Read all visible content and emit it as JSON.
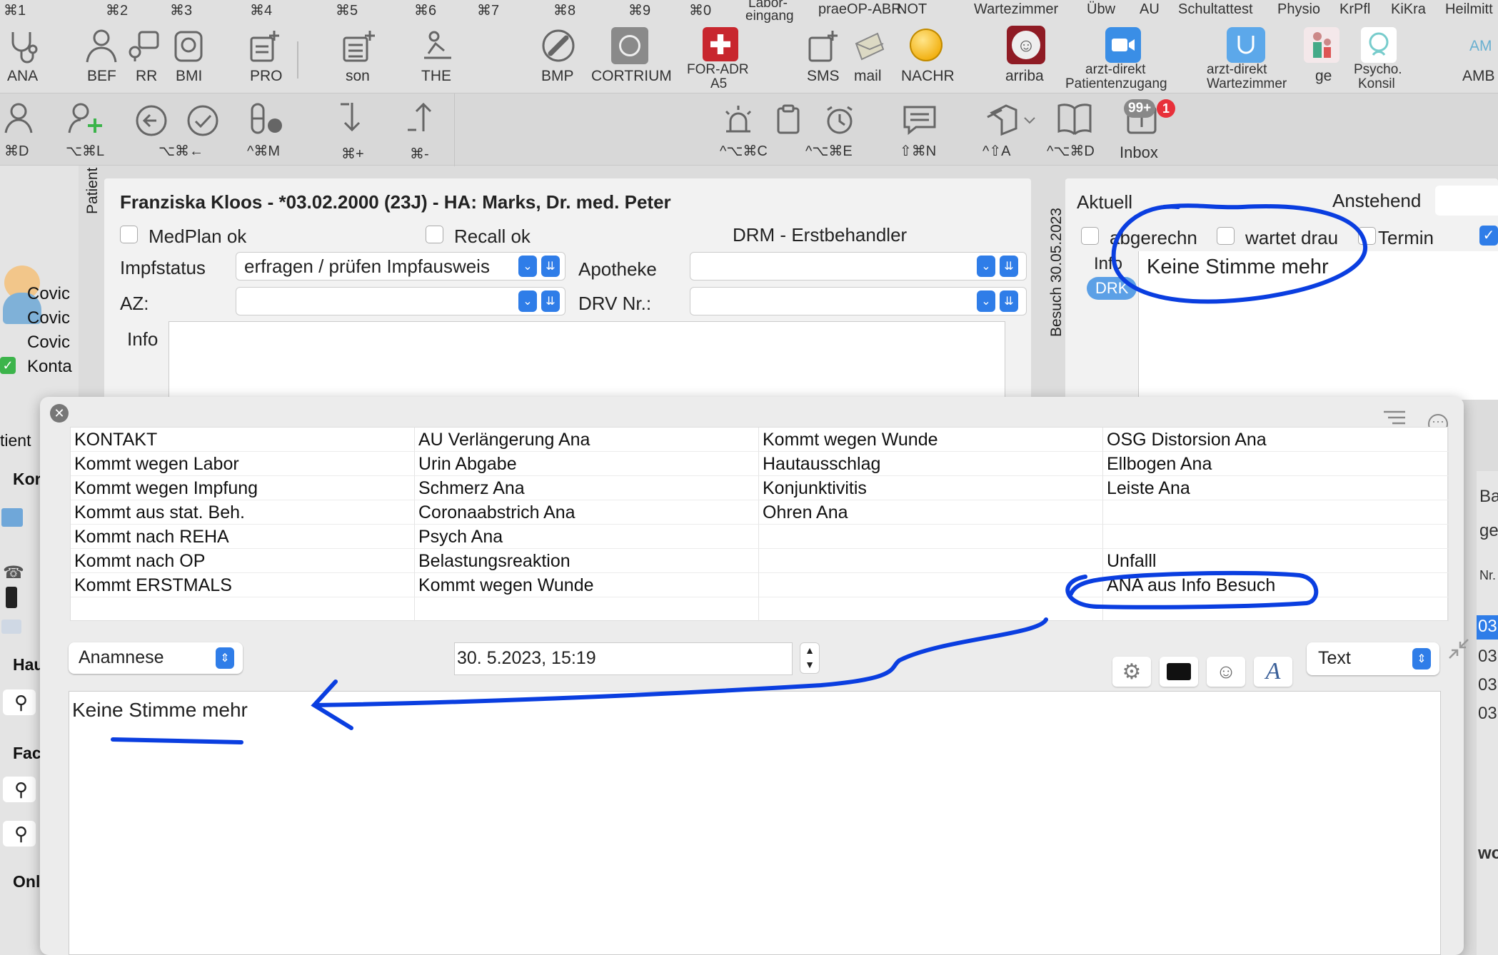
{
  "toolbar_row1": {
    "shortcuts": [
      "⌘1",
      "⌘2",
      "⌘3",
      "⌘4",
      "⌘5",
      "⌘6",
      "⌘7",
      "⌘8",
      "⌘9",
      "⌘0"
    ],
    "categories": [
      "Labor-",
      "eingang",
      "praeOP-ABR",
      "NOT",
      "Wartezimmer",
      "Übw",
      "AU",
      "Schultattest",
      "Physio",
      "KrPfl",
      "KiKra",
      "Heilmitt"
    ],
    "items": [
      "ANA",
      "BEF",
      "RR",
      "BMI",
      "PRO",
      "son",
      "THE",
      "BMP",
      "CORTRIUM",
      "FOR-ADR",
      "A5",
      "SMS",
      "mail",
      "NACHR",
      "arriba",
      "arzt-direkt",
      "Patientenzugang",
      "arzt-direkt",
      "Wartezimmer",
      "ge",
      "Psycho.",
      "Konsil",
      "AMB",
      "AM"
    ]
  },
  "toolbar_row2": {
    "shortcuts": [
      "⌘D",
      "⌥⌘L",
      "⌥⌘←",
      "^⌘M",
      "⌘+",
      "⌘-",
      "^⌥⌘C",
      "^⌥⌘E",
      "⇧⌘N",
      "^⇧A",
      "^⌥⌘D"
    ],
    "inbox_label": "Inbox",
    "inbox_badge": "99+",
    "inbox_alert": "1"
  },
  "sidebar": {
    "items": [
      "Covic",
      "Covic",
      "Covic",
      "Konta"
    ],
    "sections": [
      "tient",
      "Kor",
      "Hau",
      "Fac",
      "Onl"
    ]
  },
  "patient": {
    "vertical_label": "Patient",
    "header": "Franziska Kloos - *03.02.2000 (23J) - HA: Marks, Dr. med. Peter",
    "medplan_label": "MedPlan ok",
    "recall_label": "Recall ok",
    "drm_label": "DRM - Erstbehandler",
    "impfstatus_label": "Impfstatus",
    "impfstatus_value": "erfragen / prüfen Impfausweis",
    "apotheke_label": "Apotheke",
    "az_label": "AZ:",
    "drv_label": "DRV Nr.:",
    "info_label": "Info"
  },
  "visit": {
    "vertical_label": "Besuch 30.05.2023",
    "aktuell": "Aktuell",
    "anstehend": "Anstehend",
    "abgerechn": "abgerechn",
    "wartet": "wartet drau",
    "termin": "Termin",
    "info_label": "Info",
    "drk_badge": "DRK",
    "note": "Keine Stimme mehr"
  },
  "popup": {
    "columns": [
      [
        "KONTAKT",
        "Kommt wegen Labor",
        "Kommt wegen Impfung",
        "Kommt aus stat. Beh.",
        "Kommt nach REHA",
        "Kommt nach OP",
        "Kommt ERSTMALS",
        ""
      ],
      [
        "AU Verlängerung Ana",
        "Urin Abgabe",
        "Schmerz Ana",
        "Coronaabstrich Ana",
        "Psych Ana",
        "Belastungsreaktion",
        "Kommt wegen Wunde",
        ""
      ],
      [
        "Kommt wegen Wunde",
        "Hautausschlag",
        "Konjunktivitis",
        "Ohren Ana",
        "",
        "",
        "",
        ""
      ],
      [
        "OSG Distorsion Ana",
        "Ellbogen Ana",
        "Leiste Ana",
        "",
        "",
        "Unfalll",
        "ANA aus Info Besuch",
        ""
      ]
    ],
    "type_select": "Anamnese",
    "datetime": "30.  5.2023, 15:19",
    "format_select": "Text",
    "editor_text": "Keine Stimme mehr"
  },
  "right_edge": {
    "items": [
      "Ba",
      "ge",
      "Nr.",
      "03",
      "03",
      "03",
      "03",
      "wo"
    ]
  },
  "colors": {
    "accent": "#2f7de8",
    "annotation": "#0a3ee0",
    "background": "#dcdcdc",
    "panel": "#f2f2f2",
    "badge_red": "#e8303a"
  }
}
